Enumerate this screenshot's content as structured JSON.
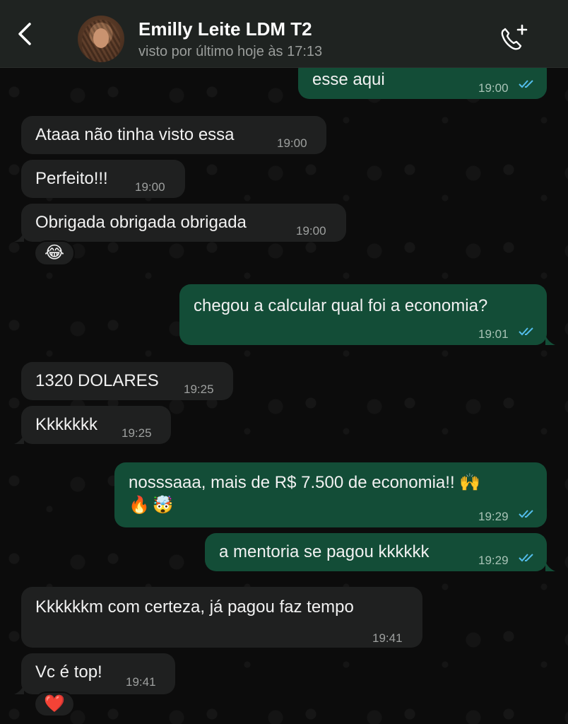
{
  "header": {
    "contact_name": "Emilly Leite LDM T2",
    "status": "visto por último hoje às 17:13",
    "back_icon": "chevron-left-icon",
    "call_icon": "phone-plus-icon"
  },
  "colors": {
    "header_bg": "#1f2321",
    "incoming_bubble": "#1f2020",
    "outgoing_bubble": "#134d37",
    "read_ticks": "#53bdeb"
  },
  "messages": [
    {
      "direction": "out",
      "text": "esse aqui",
      "time": "19:00",
      "read": true
    },
    {
      "direction": "in",
      "text": "Ataaa não tinha visto essa",
      "time": "19:00"
    },
    {
      "direction": "in",
      "text": "Perfeito!!!",
      "time": "19:00"
    },
    {
      "direction": "in",
      "text": "Obrigada obrigada obrigada",
      "time": "19:00",
      "reaction": "😂"
    },
    {
      "direction": "out",
      "text": "chegou a calcular qual foi a economia?",
      "time": "19:01",
      "read": true
    },
    {
      "direction": "in",
      "text": "1320 DOLARES",
      "time": "19:25"
    },
    {
      "direction": "in",
      "text": "Kkkkkkk",
      "time": "19:25"
    },
    {
      "direction": "out",
      "text": "nosssaaa, mais de R$ 7.500 de economia!! 🙌",
      "text_line2": "🔥🤯",
      "time": "19:29",
      "read": true
    },
    {
      "direction": "out",
      "text": "a mentoria se pagou kkkkkk",
      "time": "19:29",
      "read": true
    },
    {
      "direction": "in",
      "text": "Kkkkkkm com certeza, já pagou faz tempo",
      "time": "19:41"
    },
    {
      "direction": "in",
      "text": "Vc é top!",
      "time": "19:41",
      "reaction": "❤️"
    }
  ]
}
